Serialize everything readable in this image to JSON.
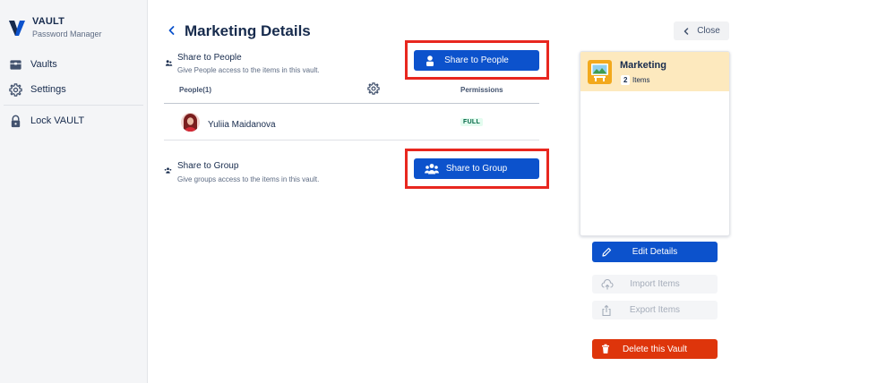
{
  "app": {
    "name": "VAULT",
    "subtitle": "Password Manager"
  },
  "sidebar": {
    "items": [
      {
        "label": "Vaults",
        "icon": "vault-icon"
      },
      {
        "label": "Settings",
        "icon": "gear-icon"
      },
      {
        "label": "Lock VAULT",
        "icon": "lock-icon"
      }
    ]
  },
  "page": {
    "title": "Marketing Details"
  },
  "share_people": {
    "title": "Share to People",
    "description": "Give People access to the items in this vault.",
    "button_label": "Share to People"
  },
  "people_table": {
    "header_people": "People(1)",
    "header_permissions": "Permissions",
    "rows": [
      {
        "name": "Yuliia Maidanova",
        "permission": "FULL"
      }
    ]
  },
  "share_group": {
    "title": "Share to Group",
    "description": "Give groups access to the items in this vault.",
    "button_label": "Share to Group"
  },
  "right_panel": {
    "close_label": "Close",
    "vault": {
      "name": "Marketing",
      "items_count": "2",
      "items_label": "Items"
    },
    "edit_label": "Edit Details",
    "import_label": "Import Items",
    "export_label": "Export Items",
    "delete_label": "Delete this Vault"
  },
  "colors": {
    "primary": "#0c52cc",
    "danger": "#de350b",
    "highlight": "#e8271f",
    "card_header": "#fde9be",
    "badge_text": "#006644"
  }
}
